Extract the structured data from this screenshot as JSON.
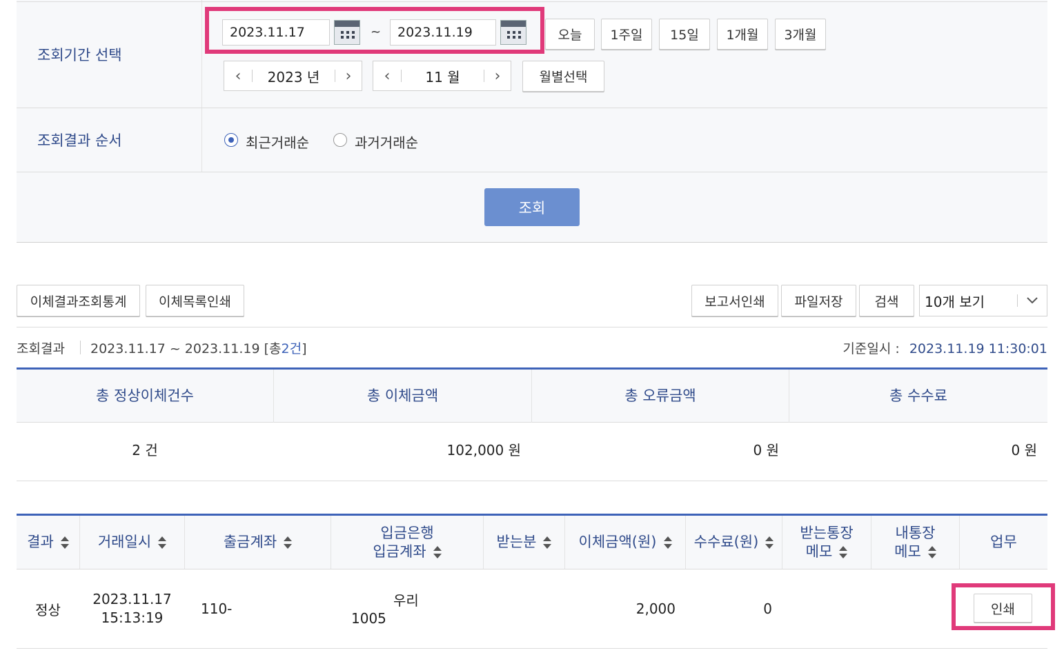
{
  "filter": {
    "period_label": "조회기간 선택",
    "start_date": "2023.11.17",
    "date_separator": "~",
    "end_date": "2023.11.19",
    "quick_buttons": [
      "오늘",
      "1주일",
      "15일",
      "1개월",
      "3개월"
    ],
    "year_value": "2023 년",
    "month_value": "11 월",
    "monthly_select_label": "월별선택",
    "order_label": "조회결과 순서",
    "order_options": [
      "최근거래순",
      "과거거래순"
    ],
    "order_selected": "최근거래순",
    "search_button": "조회"
  },
  "toolbar": {
    "stats_button": "이체결과조회통계",
    "print_list_button": "이체목록인쇄",
    "report_print_button": "보고서인쇄",
    "file_save_button": "파일저장",
    "search_button": "검색",
    "page_size_value": "10개 보기"
  },
  "result_info": {
    "label": "조회결과",
    "range": "2023.11.17 ~ 2023.11.19",
    "count_prefix": "[총",
    "count": "2건",
    "count_suffix": "]",
    "base_time_label": "기준일시 :",
    "base_time": "2023.11.19 11:30:01"
  },
  "summary": {
    "headers": [
      "총 정상이체건수",
      "총 이체금액",
      "총 오류금액",
      "총 수수료"
    ],
    "values": [
      "2 건",
      "102,000 원",
      "0 원",
      "0 원"
    ]
  },
  "table": {
    "headers": {
      "result": "결과",
      "datetime": "거래일시",
      "from_account": "출금계좌",
      "bank_line1": "입금은행",
      "bank_line2": "입금계좌",
      "recipient": "받는분",
      "amount": "이체금액(원)",
      "fee": "수수료(원)",
      "recv_memo_line1": "받는통장",
      "recv_memo_line2": "메모",
      "my_memo_line1": "내통장",
      "my_memo_line2": "메모",
      "action": "업무"
    },
    "rows": [
      {
        "result": "정상",
        "date": "2023.11.17",
        "time": "15:13:19",
        "from_account": "110-",
        "bank": "우리",
        "to_account": "1005",
        "recipient": "",
        "amount": "2,000",
        "fee": "0",
        "action_button": "인쇄"
      }
    ]
  },
  "colors": {
    "highlight": "#e03a7a",
    "primary_button": "#6b8fd0",
    "label_blue": "#2f4a8a",
    "table_border": "#3d62b8"
  }
}
